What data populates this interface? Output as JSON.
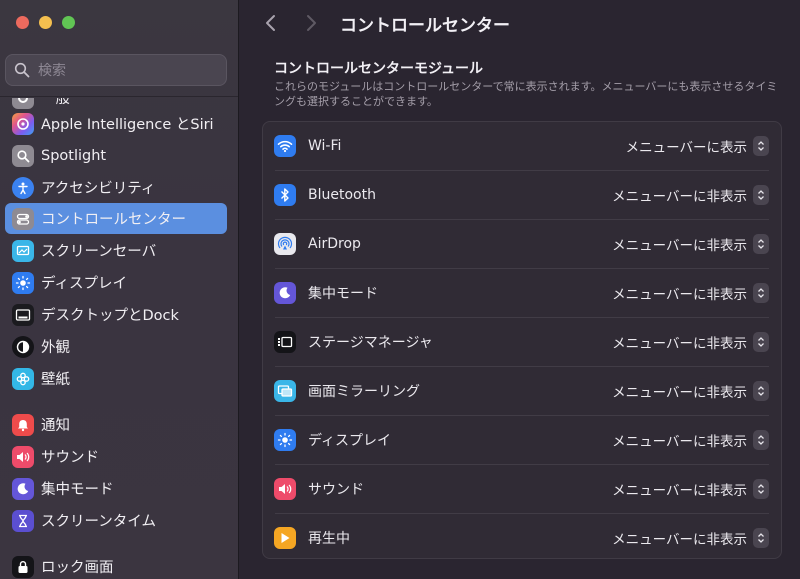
{
  "window": {
    "title": "コントロールセンター"
  },
  "sidebar": {
    "search_placeholder": "検索",
    "partial_item_label": "一般",
    "items": [
      {
        "label": "Apple Intelligence とSiri",
        "icon": "apple-intelligence-icon",
        "color": "#d86ad2"
      },
      {
        "label": "Spotlight",
        "icon": "spotlight-search-icon",
        "color": "#8e8a92"
      },
      {
        "label": "アクセシビリティ",
        "icon": "accessibility-icon",
        "color": "#3b82f0"
      },
      {
        "label": "コントロールセンター",
        "icon": "control-center-icon",
        "color": "#8e8a92"
      },
      {
        "label": "スクリーンセーバ",
        "icon": "screensaver-icon",
        "color": "#3ab6e8"
      },
      {
        "label": "ディスプレイ",
        "icon": "display-icon",
        "color": "#2f7cf0"
      },
      {
        "label": "デスクトップとDock",
        "icon": "desktop-dock-icon",
        "color": "#1b1b1f"
      },
      {
        "label": "外観",
        "icon": "appearance-icon",
        "color": "#141418"
      },
      {
        "label": "壁紙",
        "icon": "wallpaper-icon",
        "color": "#33b7e6"
      },
      {
        "label": "通知",
        "icon": "notifications-icon",
        "color": "#ee4b4b"
      },
      {
        "label": "サウンド",
        "icon": "sound-icon",
        "color": "#ee4b6a"
      },
      {
        "label": "集中モード",
        "icon": "focus-moon-icon",
        "color": "#6456d8"
      },
      {
        "label": "スクリーンタイム",
        "icon": "screen-time-hourglass-icon",
        "color": "#5b4fd0"
      },
      {
        "label": "ロック画面",
        "icon": "lock-screen-icon",
        "color": "#141418"
      }
    ],
    "active_index": 3
  },
  "main": {
    "section_title": "コントロールセンターモジュール",
    "section_description": "これらのモジュールはコントロールセンターで常に表示されます。メニューバーにも表示させるタイミングも選択することができます。",
    "modules": [
      {
        "label": "Wi-Fi",
        "value": "メニューバーに表示",
        "icon": "wifi-icon",
        "color": "#2f7cf0"
      },
      {
        "label": "Bluetooth",
        "value": "メニューバーに非表示",
        "icon": "bluetooth-icon",
        "color": "#2f7cf0"
      },
      {
        "label": "AirDrop",
        "value": "メニューバーに非表示",
        "icon": "airdrop-icon",
        "color": "#e9e9ee"
      },
      {
        "label": "集中モード",
        "value": "メニューバーに非表示",
        "icon": "focus-moon-icon",
        "color": "#6456d8"
      },
      {
        "label": "ステージマネージャ",
        "value": "メニューバーに非表示",
        "icon": "stage-manager-icon",
        "color": "#141418"
      },
      {
        "label": "画面ミラーリング",
        "value": "メニューバーに非表示",
        "icon": "screen-mirroring-icon",
        "color": "#3ab6e8"
      },
      {
        "label": "ディスプレイ",
        "value": "メニューバーに非表示",
        "icon": "display-brightness-icon",
        "color": "#2f7cf0"
      },
      {
        "label": "サウンド",
        "value": "メニューバーに非表示",
        "icon": "sound-icon",
        "color": "#ee4b6a"
      },
      {
        "label": "再生中",
        "value": "メニューバーに非表示",
        "icon": "now-playing-icon",
        "color": "#f5a623"
      }
    ]
  },
  "colors": {
    "accent": "#5b8fe0",
    "window_bg": "#2a2530",
    "sidebar_bg": "#3b3740"
  }
}
